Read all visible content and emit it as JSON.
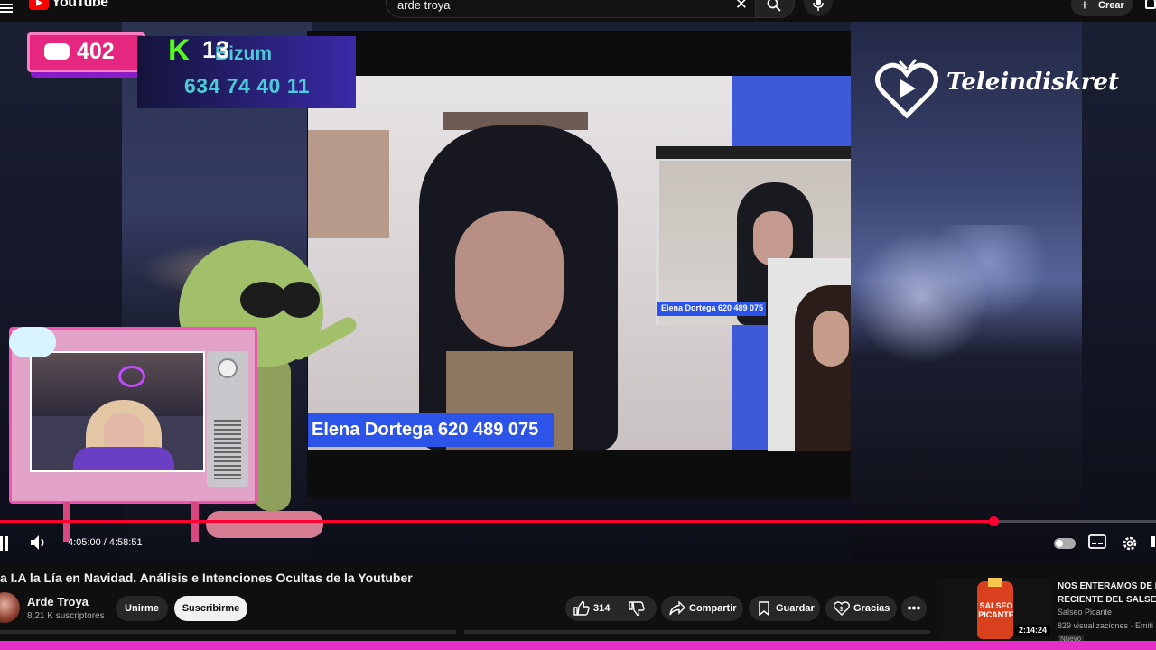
{
  "masthead": {
    "logo_text": "YouTube",
    "search_value": "arde troya",
    "create_label": "Crear"
  },
  "overlay": {
    "chat_count": "402",
    "kick_count": "13",
    "bizum_label": "Bizum",
    "bizum_phone": "634 74 40 11",
    "brand_logo_text": "Teleindiskret",
    "main_name_tag": "Elena Dortega 620 489 075",
    "sub_name_tag": "Elena Dortega 620 489 075"
  },
  "player": {
    "time_current": "4:05:00",
    "time_total": "4:58:51",
    "time_display": "4:05:00 / 4:58:51",
    "progress_fraction": 0.82
  },
  "video": {
    "title": "a I.A la Lía en Navidad. Análisis e Intenciones Ocultas de la Youtuber",
    "channel_name": "Arde Troya",
    "subscribers": "8,21 K suscriptores",
    "unjoin_label": "Unirme",
    "subscribe_label": "Suscribirme",
    "likes": "314",
    "share_label": "Compartir",
    "save_label": "Guardar",
    "thanks_label": "Gracias"
  },
  "recommendation": {
    "title": "NOS ENTERAMOS DE L RECIENTE DEL SALSEO",
    "channel": "Salseo Picante",
    "views": "829 visualizaciones · Emiti",
    "duration": "2:14:24",
    "badge": "Nuevo",
    "thumb_text": "SALSEO PICANTE"
  },
  "colors": {
    "accent_red": "#ff0033",
    "kick_green": "#53fc18",
    "overlay_pink": "#e6277f",
    "name_tag_blue": "#2d54e8"
  }
}
